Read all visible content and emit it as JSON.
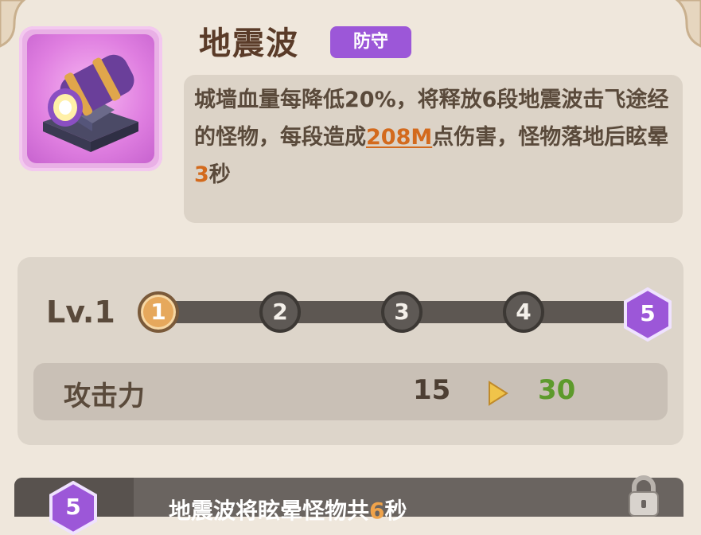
{
  "skill": {
    "name": "地震波",
    "tag": "防守",
    "description": {
      "part1": "城墙血量每降低20%，将释放6段地震波击飞途经的怪物，每段造成",
      "damage": "208M",
      "part2": "点伤害，怪物落地后眩晕",
      "stun_seconds": "3",
      "part3": "秒"
    }
  },
  "level": {
    "label": "Lv.1",
    "current": 1,
    "nodes": [
      "1",
      "2",
      "3",
      "4"
    ],
    "max_node": "5"
  },
  "stat": {
    "name": "攻击力",
    "current_value": "15",
    "next_value": "30"
  },
  "unlock": {
    "level": "5",
    "text_before": "地震波将眩晕怪物共",
    "value": "6",
    "text_after": "秒"
  },
  "colors": {
    "tag_bg": "#9c57d8",
    "active_node": "#e6a85c",
    "highlight": "#d36a1d",
    "next_value": "#5d9a2c",
    "hex_node": "#9c57d8"
  },
  "icons": [
    "wave-cannon-icon",
    "play-arrow-icon",
    "lock-icon"
  ]
}
